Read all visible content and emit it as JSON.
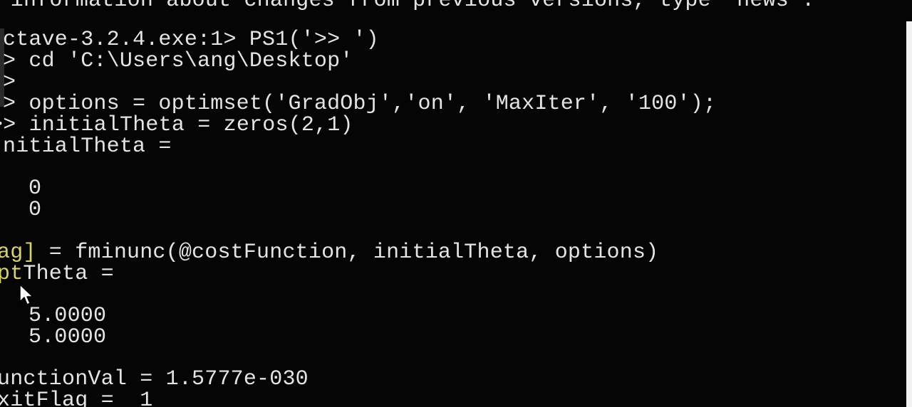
{
  "terminal": {
    "lines": {
      "l0": "For information about changes from previous versions, type `news'.",
      "l1": "ctave-3.2.4.exe:1> PS1('>> ')",
      "l2": "> cd 'C:\\Users\\ang\\Desktop'",
      "l3": ">",
      "l4": "> options = optimset('GradObj','on', 'MaxIter', '100');",
      "l5": "> initialTheta = zeros(2,1)",
      "l6": "nitialTheta =",
      "l7": "0",
      "l8": "0",
      "l9_a": "ag]",
      "l9_b": " = fminunc(@costFunction, initialTheta, options)",
      "l10_a": "pt",
      "l10_b": "Theta =",
      "l11": "5.0000",
      "l12": "5.0000",
      "l13": "unctionVal = 1.5777e-030",
      "l14": "xitFlag =  1"
    }
  },
  "colors": {
    "background": "#050505",
    "text": "#e4e4e4",
    "highlight": "#d8d26a"
  }
}
